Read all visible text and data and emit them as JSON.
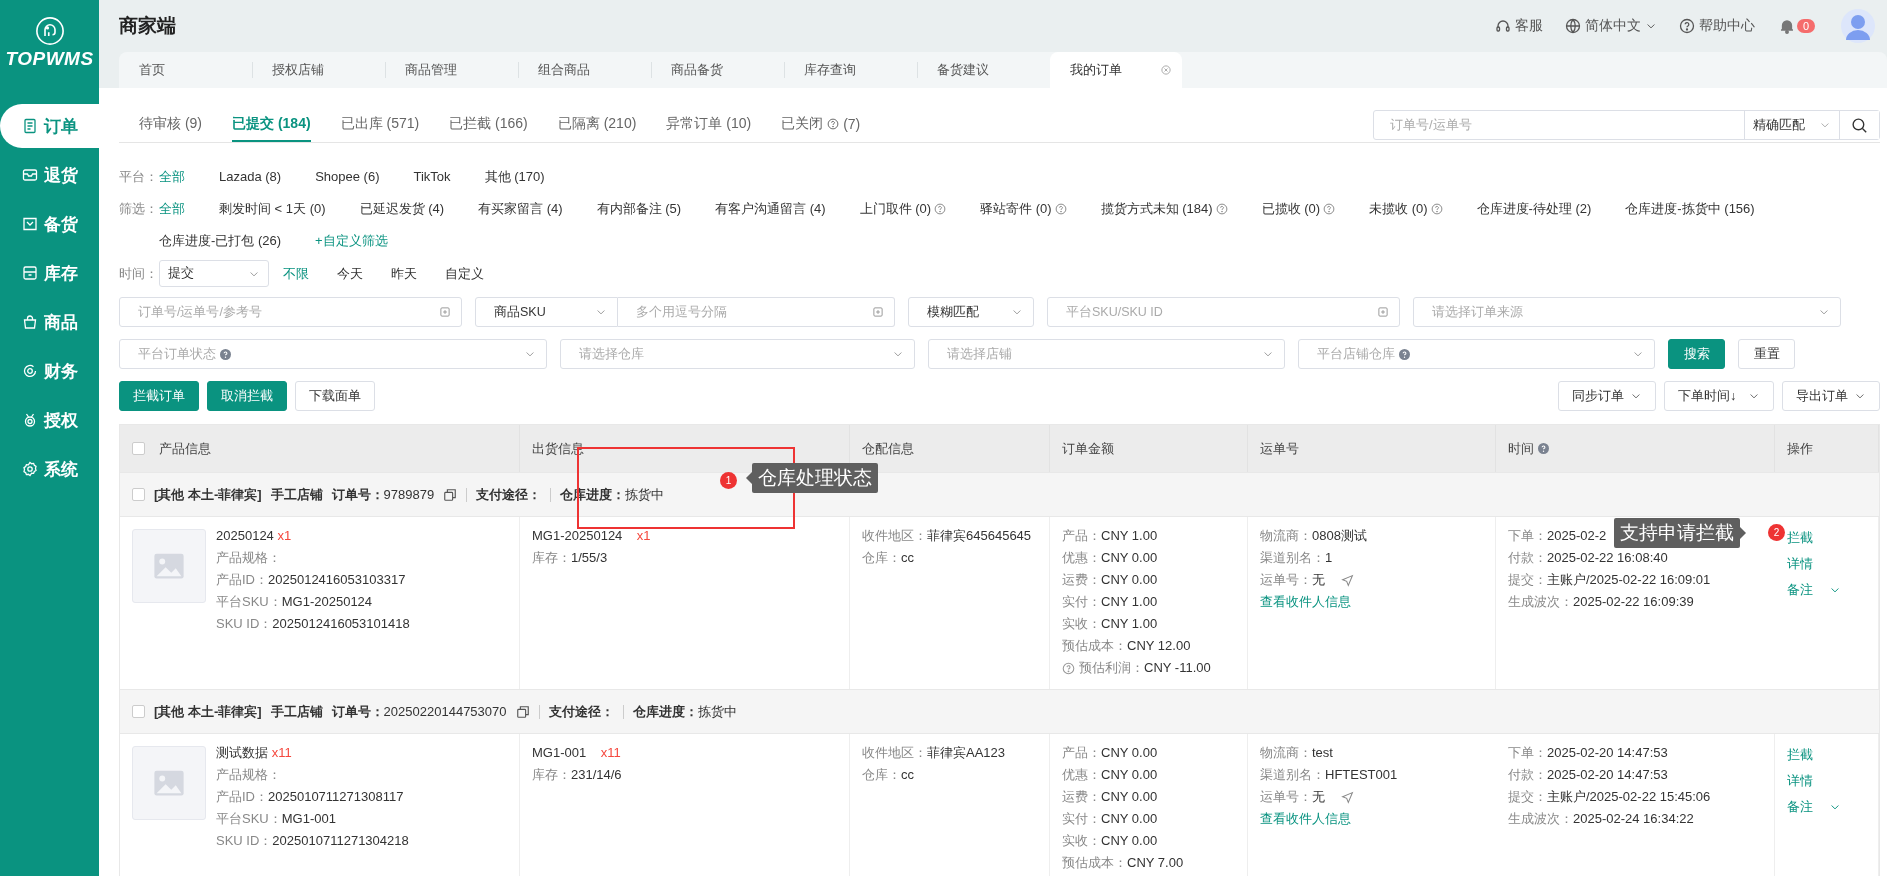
{
  "sidebar": {
    "logo_text": "TOPWMS",
    "items": [
      {
        "label": "订单",
        "selected": true
      },
      {
        "label": "退货",
        "selected": false
      },
      {
        "label": "备货",
        "selected": false
      },
      {
        "label": "库存",
        "selected": false
      },
      {
        "label": "商品",
        "selected": false
      },
      {
        "label": "财务",
        "selected": false
      },
      {
        "label": "授权",
        "selected": false
      },
      {
        "label": "系统",
        "selected": false
      }
    ]
  },
  "header": {
    "title": "商家端",
    "service": "客服",
    "language": "简体中文",
    "help": "帮助中心",
    "notification_count": "0"
  },
  "page_tabs": [
    {
      "label": "首页",
      "selected": false
    },
    {
      "label": "授权店铺",
      "selected": false
    },
    {
      "label": "商品管理",
      "selected": false
    },
    {
      "label": "组合商品",
      "selected": false
    },
    {
      "label": "商品备货",
      "selected": false
    },
    {
      "label": "库存查询",
      "selected": false
    },
    {
      "label": "备货建议",
      "selected": false
    },
    {
      "label": "我的订单",
      "selected": true
    }
  ],
  "status_tabs": [
    {
      "label": "待审核",
      "count": "(9)",
      "help": false,
      "selected": false
    },
    {
      "label": "已提交",
      "count": "(184)",
      "help": false,
      "selected": true
    },
    {
      "label": "已出库",
      "count": "(571)",
      "help": false,
      "selected": false
    },
    {
      "label": "已拦截",
      "count": "(166)",
      "help": false,
      "selected": false
    },
    {
      "label": "已隔离",
      "count": "(210)",
      "help": false,
      "selected": false
    },
    {
      "label": "异常订单",
      "count": "(10)",
      "help": false,
      "selected": false
    },
    {
      "label": "已关闭",
      "count": "(7)",
      "help": true,
      "selected": false
    }
  ],
  "quick_search": {
    "placeholder": "订单号/运单号",
    "match": "精确匹配"
  },
  "platform_filter": {
    "label": "平台：",
    "options": [
      {
        "label": "全部",
        "help": false,
        "selected": true
      },
      {
        "label": "Lazada (8)",
        "help": false,
        "selected": false
      },
      {
        "label": "Shopee (6)",
        "help": false,
        "selected": false
      },
      {
        "label": "TikTok",
        "help": false,
        "selected": false
      },
      {
        "label": "其他 (170)",
        "help": false,
        "selected": false
      }
    ]
  },
  "quick_filter": {
    "label": "筛选：",
    "options": [
      {
        "label": "全部",
        "help": false,
        "selected": true
      },
      {
        "label": "剩发时间 < 1天 (0)",
        "help": false,
        "selected": false
      },
      {
        "label": "已延迟发货 (4)",
        "help": false,
        "selected": false
      },
      {
        "label": "有买家留言 (4)",
        "help": false,
        "selected": false
      },
      {
        "label": "有内部备注 (5)",
        "help": false,
        "selected": false
      },
      {
        "label": "有客户沟通留言 (4)",
        "help": false,
        "selected": false
      },
      {
        "label": "上门取件 (0)",
        "help": true,
        "selected": false
      },
      {
        "label": "驿站寄件 (0)",
        "help": true,
        "selected": false
      },
      {
        "label": "揽货方式未知 (184)",
        "help": true,
        "selected": false
      },
      {
        "label": "已揽收 (0)",
        "help": true,
        "selected": false
      },
      {
        "label": "未揽收 (0)",
        "help": true,
        "selected": false
      },
      {
        "label": "仓库进度-待处理 (2)",
        "help": false,
        "selected": false
      },
      {
        "label": "仓库进度-拣货中 (156)",
        "help": false,
        "selected": false
      },
      {
        "label": "仓库进度-已打包 (26)",
        "help": false,
        "selected": false
      }
    ],
    "custom_filter": "+自定义筛选"
  },
  "time_filter": {
    "label": "时间：",
    "field": "提交",
    "options": [
      {
        "label": "不限",
        "selected": true
      },
      {
        "label": "今天",
        "selected": false
      },
      {
        "label": "昨天",
        "selected": false
      },
      {
        "label": "自定义",
        "selected": false
      }
    ]
  },
  "search_rows": [
    [
      {
        "kind": "input",
        "placeholder": "订单号/运单号/参考号"
      },
      {
        "kind": "select",
        "value": "商品SKU",
        "help": false
      },
      {
        "kind": "input",
        "placeholder": "多个用逗号分隔"
      },
      {
        "kind": "select",
        "value": "模糊匹配",
        "help": false
      },
      {
        "kind": "input",
        "placeholder": "平台SKU/SKU ID"
      },
      {
        "kind": "select",
        "placeholder": "请选择订单来源",
        "help": false
      }
    ],
    [
      {
        "kind": "select",
        "placeholder": "平台订单状态",
        "help": true
      },
      {
        "kind": "select",
        "placeholder": "请选择仓库",
        "help": false
      },
      {
        "kind": "select",
        "placeholder": "请选择店铺",
        "help": false
      },
      {
        "kind": "select",
        "placeholder": "平台店铺仓库",
        "help": true
      },
      {
        "kind": "primary",
        "label": "搜索"
      },
      {
        "kind": "default",
        "label": "重置"
      }
    ]
  ],
  "actions": [
    {
      "kind": "primary",
      "label": "拦截订单"
    },
    {
      "kind": "primary",
      "label": "取消拦截"
    },
    {
      "kind": "default",
      "label": "下载面单"
    }
  ],
  "tools": [
    {
      "kind": "dropdown",
      "label": "同步订单"
    },
    {
      "kind": "select",
      "label": "下单时间↓"
    },
    {
      "kind": "dropdown",
      "label": "导出订单"
    }
  ],
  "table": {
    "all_checked": false,
    "columns": [
      {
        "label": "产品信息",
        "help": false
      },
      {
        "label": "出货信息",
        "help": false
      },
      {
        "label": "仓配信息",
        "help": false
      },
      {
        "label": "订单金额",
        "help": false
      },
      {
        "label": "运单号",
        "help": false
      },
      {
        "label": "时间",
        "help": true
      },
      {
        "label": "操作",
        "help": false
      }
    ],
    "orders": [
      {
        "checked": false,
        "tags": "[其他 本土-菲律宾]",
        "store": "手工店铺",
        "order_no_label": "订单号：",
        "order_no": "9789879",
        "payment_label": "支付途径：",
        "progress_label": "仓库进度：",
        "progress": "拣货中",
        "product": {
          "name": "20250124",
          "qty": "x1",
          "fields": [
            {
              "label": "产品规格："
            },
            {
              "label": "产品ID：",
              "value": "2025012416053103317"
            },
            {
              "label": "平台SKU：",
              "value": "MG1-20250124"
            },
            {
              "label": "SKU ID：",
              "value": "2025012416053101418"
            }
          ]
        },
        "shipment": {
          "sku": "MG1-20250124",
          "qty": "x1",
          "stock_label": "库存：",
          "stock": "1/55/3"
        },
        "warehouse": [
          {
            "label": "收件地区：",
            "value": "菲律宾645645645"
          },
          {
            "label": "仓库：",
            "value": "cc"
          }
        ],
        "amounts": [
          {
            "label": "产品：",
            "value": "CNY 1.00",
            "help": false
          },
          {
            "label": "优惠：",
            "value": "CNY 0.00",
            "help": false
          },
          {
            "label": "运费：",
            "value": "CNY 0.00",
            "help": false
          },
          {
            "label": "实付：",
            "value": "CNY 1.00",
            "help": false
          },
          {
            "label": "实收：",
            "value": "CNY 1.00",
            "help": false
          },
          {
            "label": "预估成本：",
            "value": "CNY 12.00",
            "help": false
          },
          {
            "label": "预估利润：",
            "value": "CNY -11.00",
            "help": true
          }
        ],
        "waybill": {
          "carrier_label": "物流商：",
          "carrier": "0808测试",
          "channel_label": "渠道别名：",
          "channel": "1",
          "number_label": "运单号：",
          "number": "无",
          "link": "查看收件人信息"
        },
        "times": [
          {
            "label": "下单：",
            "value": "2025-02-2"
          },
          {
            "label": "付款：",
            "value": "2025-02-22 16:08:40"
          },
          {
            "label": "提交：",
            "value": "主账户/2025-02-22 16:09:01"
          },
          {
            "label": "生成波次：",
            "value": "2025-02-22 16:09:39"
          }
        ],
        "operations": [
          "拦截",
          "详情",
          "备注"
        ]
      },
      {
        "checked": false,
        "tags": "[其他 本土-菲律宾]",
        "store": "手工店铺",
        "order_no_label": "订单号：",
        "order_no": "20250220144753070",
        "payment_label": "支付途径：",
        "progress_label": "仓库进度：",
        "progress": "拣货中",
        "product": {
          "name": "测试数据",
          "qty": "x11",
          "fields": [
            {
              "label": "产品规格："
            },
            {
              "label": "产品ID：",
              "value": "2025010711271308117"
            },
            {
              "label": "平台SKU：",
              "value": "MG1-001"
            },
            {
              "label": "SKU ID：",
              "value": "2025010711271304218"
            }
          ]
        },
        "shipment": {
          "sku": "MG1-001",
          "qty": "x11",
          "stock_label": "库存：",
          "stock": "231/14/6"
        },
        "warehouse": [
          {
            "label": "收件地区：",
            "value": "菲律宾AA123"
          },
          {
            "label": "仓库：",
            "value": "cc"
          }
        ],
        "amounts": [
          {
            "label": "产品：",
            "value": "CNY 0.00",
            "help": false
          },
          {
            "label": "优惠：",
            "value": "CNY 0.00",
            "help": false
          },
          {
            "label": "运费：",
            "value": "CNY 0.00",
            "help": false
          },
          {
            "label": "实付：",
            "value": "CNY 0.00",
            "help": false
          },
          {
            "label": "实收：",
            "value": "CNY 0.00",
            "help": false
          },
          {
            "label": "预估成本：",
            "value": "CNY 7.00",
            "help": false
          }
        ],
        "waybill": {
          "carrier_label": "物流商：",
          "carrier": "test",
          "channel_label": "渠道别名：",
          "channel": "HFTEST001",
          "number_label": "运单号：",
          "number": "无",
          "link": "查看收件人信息"
        },
        "times": [
          {
            "label": "下单：",
            "value": "2025-02-20 14:47:53"
          },
          {
            "label": "付款：",
            "value": "2025-02-20 14:47:53"
          },
          {
            "label": "提交：",
            "value": "主账户/2025-02-22 15:45:06"
          },
          {
            "label": "生成波次：",
            "value": "2025-02-24 16:34:22"
          }
        ],
        "operations": [
          "拦截",
          "详情",
          "备注"
        ]
      }
    ]
  },
  "annotations": [
    {
      "number": "1",
      "text": "仓库处理状态",
      "highlight_box": true
    },
    {
      "number": "2",
      "text": "支持申请拦截",
      "highlight_box": false
    }
  ]
}
